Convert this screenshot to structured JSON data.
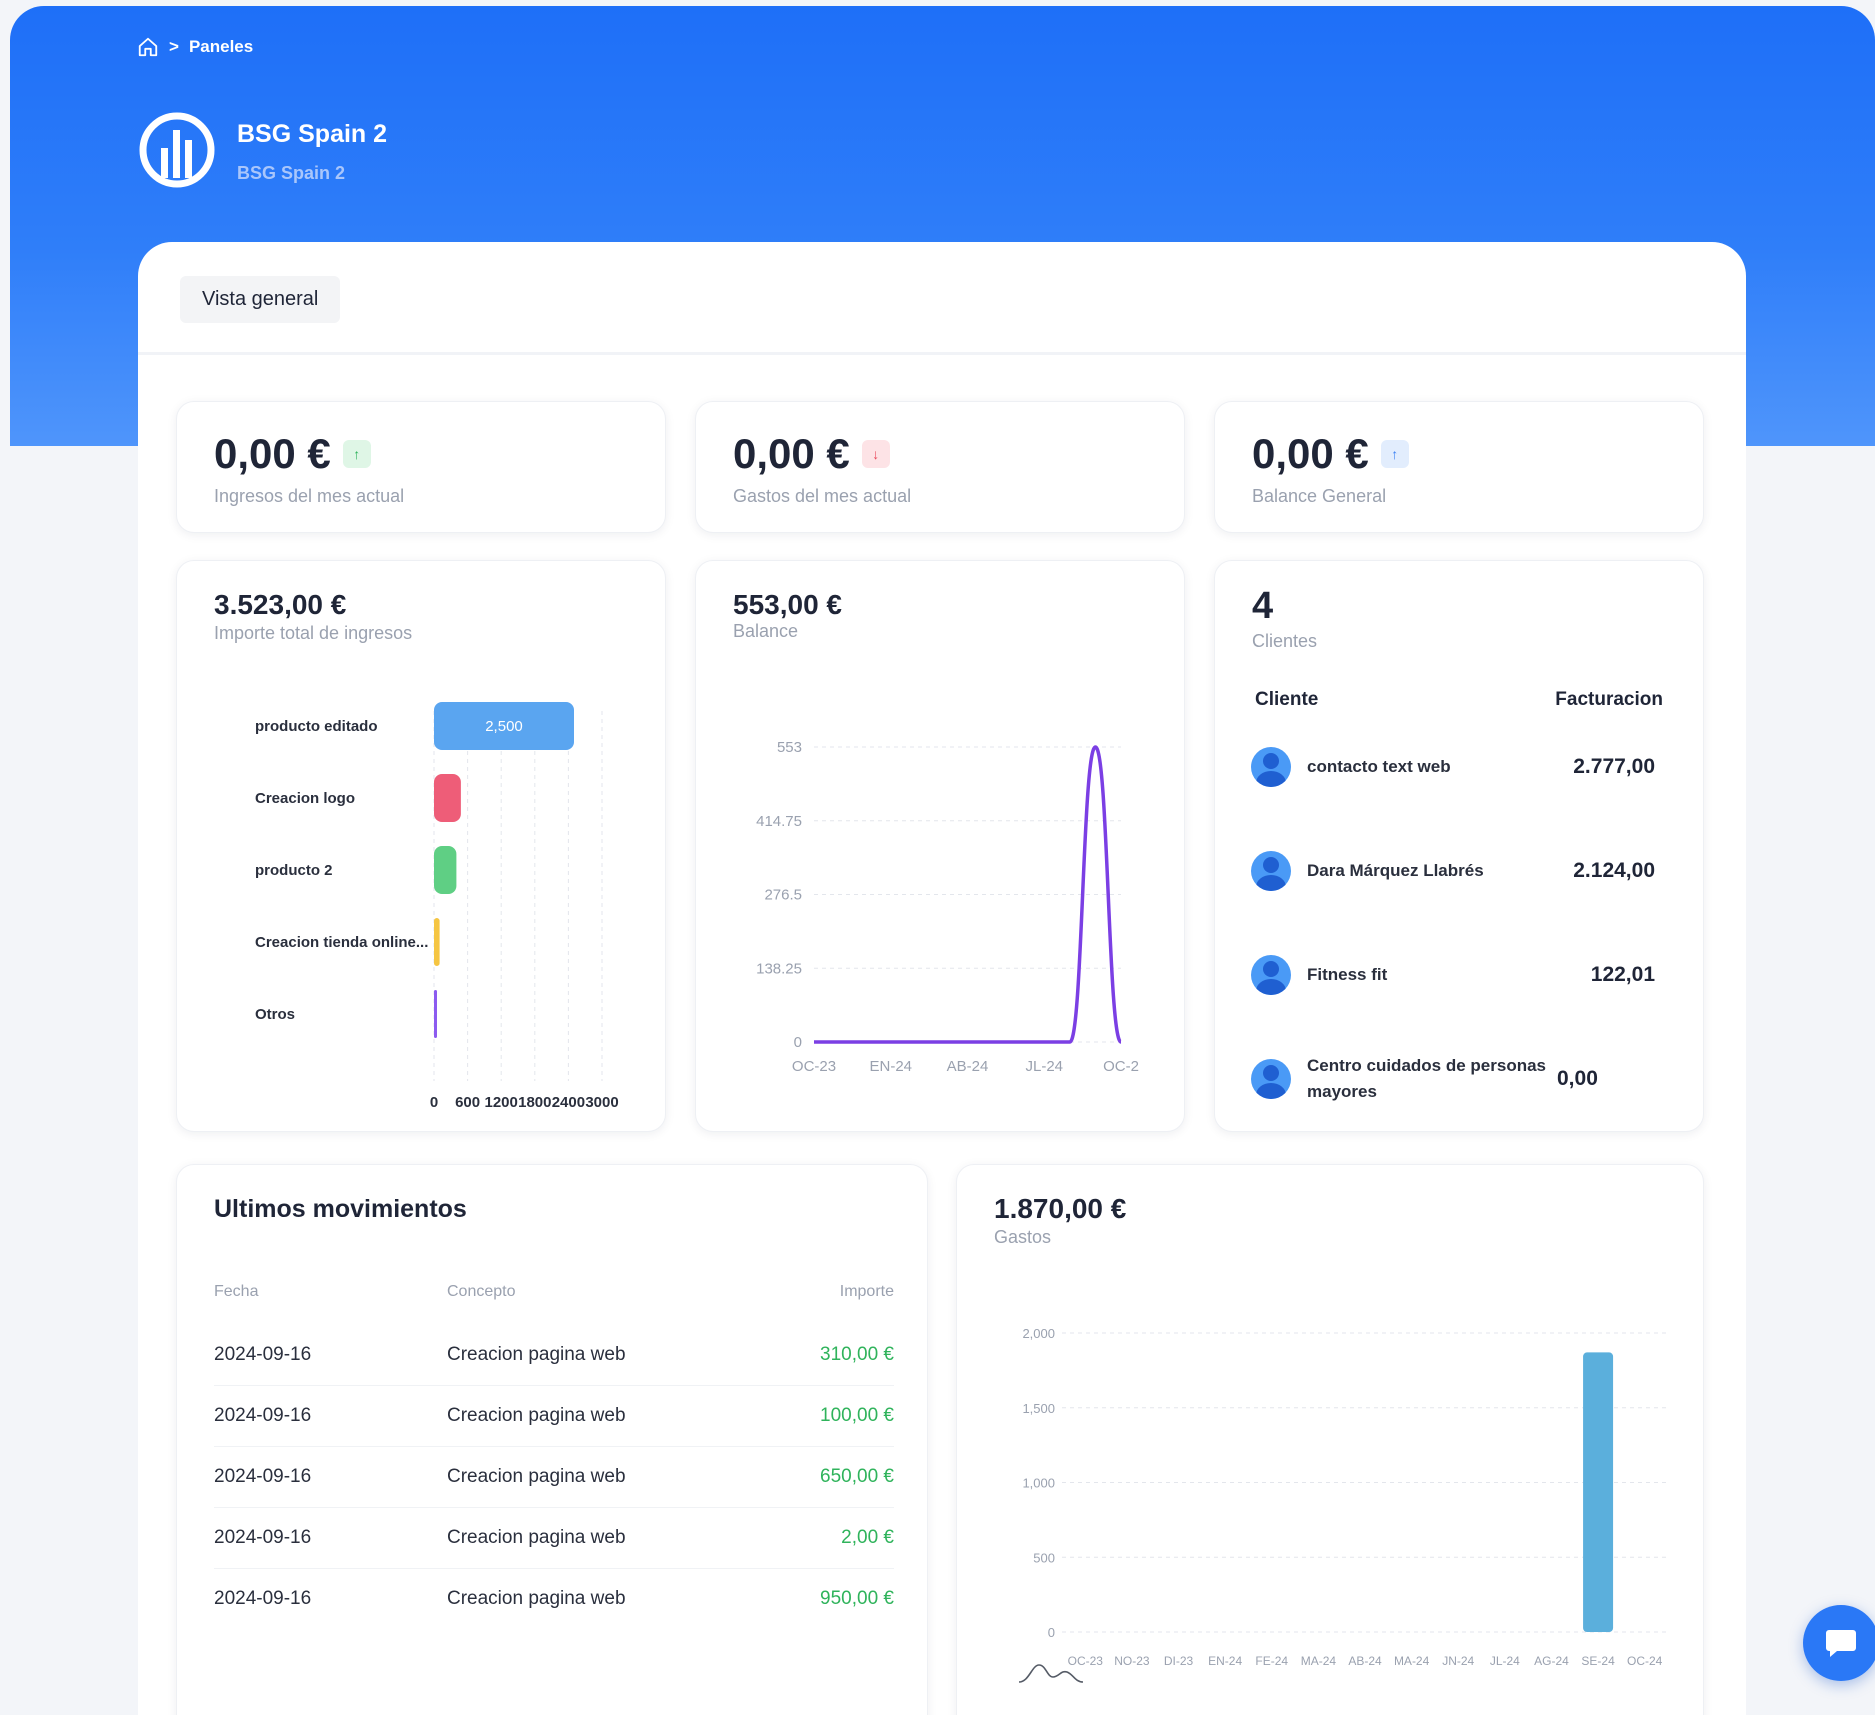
{
  "breadcrumb": {
    "home_icon": "home-icon",
    "separator": ">",
    "current": "Paneles"
  },
  "brand": {
    "title": "BSG Spain 2",
    "subtitle": "BSG Spain 2",
    "logo_icon": "bar-chart-circle-icon"
  },
  "tabs": [
    {
      "label": "Vista general",
      "active": true
    }
  ],
  "kpis": [
    {
      "value": "0,00 €",
      "label": "Ingresos del mes actual",
      "trend": "up",
      "badge_color": "#2fb35b"
    },
    {
      "value": "0,00 €",
      "label": "Gastos del mes actual",
      "trend": "down",
      "badge_color": "#ea4b5d"
    },
    {
      "value": "0,00 €",
      "label": "Balance General",
      "trend": "up",
      "badge_color": "#3d82f3"
    }
  ],
  "ingresos": {
    "total": "3.523,00 €",
    "label": "Importe total de ingresos"
  },
  "balance": {
    "total": "553,00 €",
    "label": "Balance"
  },
  "clientes": {
    "count": "4",
    "label": "Clientes",
    "col_client": "Cliente",
    "col_billing": "Facturacion",
    "rows": [
      {
        "name": "contacto text web",
        "amount": "2.777,00"
      },
      {
        "name": "Dara Márquez Llabrés",
        "amount": "2.124,00"
      },
      {
        "name": "Fitness fit",
        "amount": "122,01"
      },
      {
        "name": "Centro cuidados de personas mayores",
        "amount": "0,00"
      }
    ]
  },
  "movimientos": {
    "title": "Ultimos movimientos",
    "headers": {
      "fecha": "Fecha",
      "concepto": "Concepto",
      "importe": "Importe"
    },
    "rows": [
      {
        "fecha": "2024-09-16",
        "concepto": "Creacion pagina web",
        "importe": "310,00 €"
      },
      {
        "fecha": "2024-09-16",
        "concepto": "Creacion pagina web",
        "importe": "100,00 €"
      },
      {
        "fecha": "2024-09-16",
        "concepto": "Creacion pagina web",
        "importe": "650,00 €"
      },
      {
        "fecha": "2024-09-16",
        "concepto": "Creacion pagina web",
        "importe": "2,00 €"
      },
      {
        "fecha": "2024-09-16",
        "concepto": "Creacion pagina web",
        "importe": "950,00 €"
      }
    ]
  },
  "gastos": {
    "total": "1.870,00 €",
    "label": "Gastos"
  },
  "chat": {
    "icon": "chat-bubble-icon"
  },
  "chart_data": [
    {
      "type": "bar",
      "orientation": "horizontal",
      "categories": [
        "producto editado",
        "Creacion logo",
        "producto 2",
        "Creacion tienda online...",
        "Otros"
      ],
      "values": [
        2500,
        480,
        400,
        100,
        20
      ],
      "data_labels": [
        "2,500",
        "",
        "",
        "",
        ""
      ],
      "colors": [
        "#5aa5f0",
        "#ee5d78",
        "#5fcf84",
        "#f5c542",
        "#8c5bf0"
      ],
      "x_ticks": [
        "0",
        "600",
        "1200",
        "1800",
        "2400",
        "3000"
      ],
      "xlim": [
        0,
        3000
      ],
      "grid": true
    },
    {
      "type": "line",
      "x": [
        "OC-23",
        "NO-23",
        "DI-23",
        "EN-24",
        "FE-24",
        "MA-24",
        "AB-24",
        "MA-24",
        "JN-24",
        "JL-24",
        "AG-24",
        "SE-24",
        "OC-24"
      ],
      "series": [
        {
          "values": [
            0,
            0,
            0,
            0,
            0,
            0,
            0,
            0,
            0,
            0,
            0,
            553,
            0
          ]
        }
      ],
      "x_tick_labels": [
        "OC-23",
        "EN-24",
        "AB-24",
        "JL-24",
        "OC-2"
      ],
      "x_tick_positions": [
        "OC-23",
        "EN-24",
        "AB-24",
        "JL-24",
        "OC-24"
      ],
      "y_ticks": [
        "0",
        "138.25",
        "276.5",
        "414.75",
        "553"
      ],
      "ylim": [
        0,
        553
      ],
      "color": "#7b3fe4",
      "grid": true
    },
    {
      "type": "bar",
      "categories": [
        "OC-23",
        "NO-23",
        "DI-23",
        "EN-24",
        "FE-24",
        "MA-24",
        "AB-24",
        "MA-24",
        "JN-24",
        "JL-24",
        "AG-24",
        "SE-24",
        "OC-24"
      ],
      "values": [
        0,
        0,
        0,
        0,
        0,
        0,
        0,
        0,
        0,
        0,
        0,
        1870,
        0
      ],
      "y_ticks": [
        "0",
        "500",
        "1,000",
        "1,500",
        "2,000"
      ],
      "ylim": [
        0,
        2000
      ],
      "color": "#5bafdc",
      "grid": true
    }
  ]
}
